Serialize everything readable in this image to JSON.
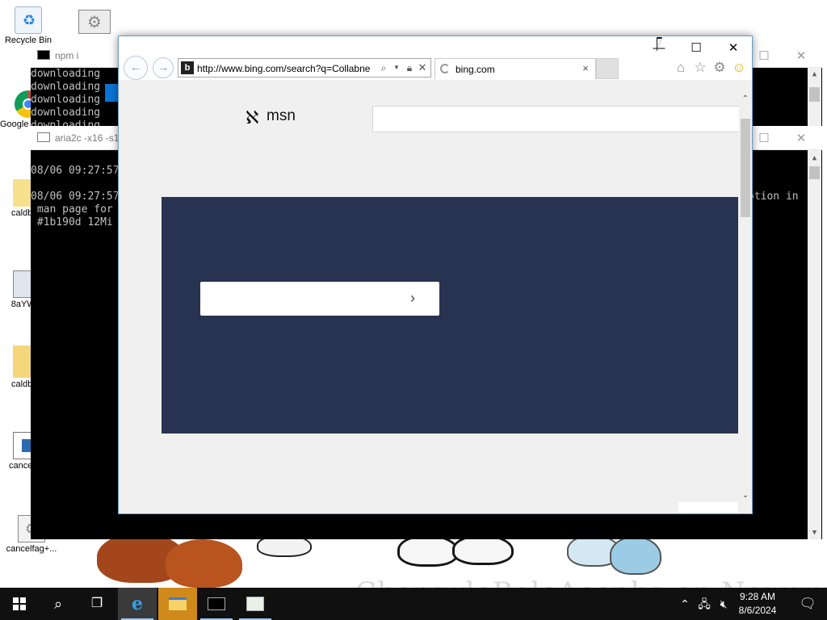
{
  "desktop": {
    "wallpaper_text": "CherrydoBoloAconha on Newgrounds",
    "icons": [
      {
        "label": "Recycle Bin",
        "icon": "recycle-bin-icon"
      },
      {
        "label": "",
        "icon": "settings-shortcut-icon"
      },
      {
        "label": "Google Chrome",
        "icon": "chrome-icon"
      },
      {
        "label": "caldbj...",
        "icon": "file-icon"
      },
      {
        "label": "8aYW...",
        "icon": "image-file-icon"
      },
      {
        "label": "caldbj...",
        "icon": "folder-icon"
      },
      {
        "label": "cancelf...",
        "icon": "window-file-icon"
      },
      {
        "label": "cancelfag+...",
        "icon": "settings-file-icon"
      }
    ]
  },
  "console_npm": {
    "title": "npm i",
    "lines": [
      "downloading",
      "downloading",
      "downloading",
      "downloading",
      "downloading"
    ]
  },
  "console_aria": {
    "title": "aria2c -x16 -s1",
    "lines": [
      "08/06 09:27:57",
      "",
      "08/06 09:27:57",
      " man page for",
      " #1b190d 12Mi"
    ],
    "right_text": "ption in"
  },
  "ie": {
    "window_controls": {
      "minimize": "—",
      "maximize": "☐",
      "close": "✕"
    },
    "back": "←",
    "forward": "→",
    "address_url": "http://www.bing.com/search?q=Collabne",
    "tab_title": "bing.com",
    "tab_close": "×",
    "page": {
      "brand": "msn",
      "search_value": "",
      "hero_card_arrow": "›"
    }
  },
  "taskbar": {
    "time": "9:28 AM",
    "date": "8/6/2024"
  },
  "colors": {
    "hero": "#283352",
    "taskbar": "#101010",
    "ie_border": "#6d9bc7"
  }
}
